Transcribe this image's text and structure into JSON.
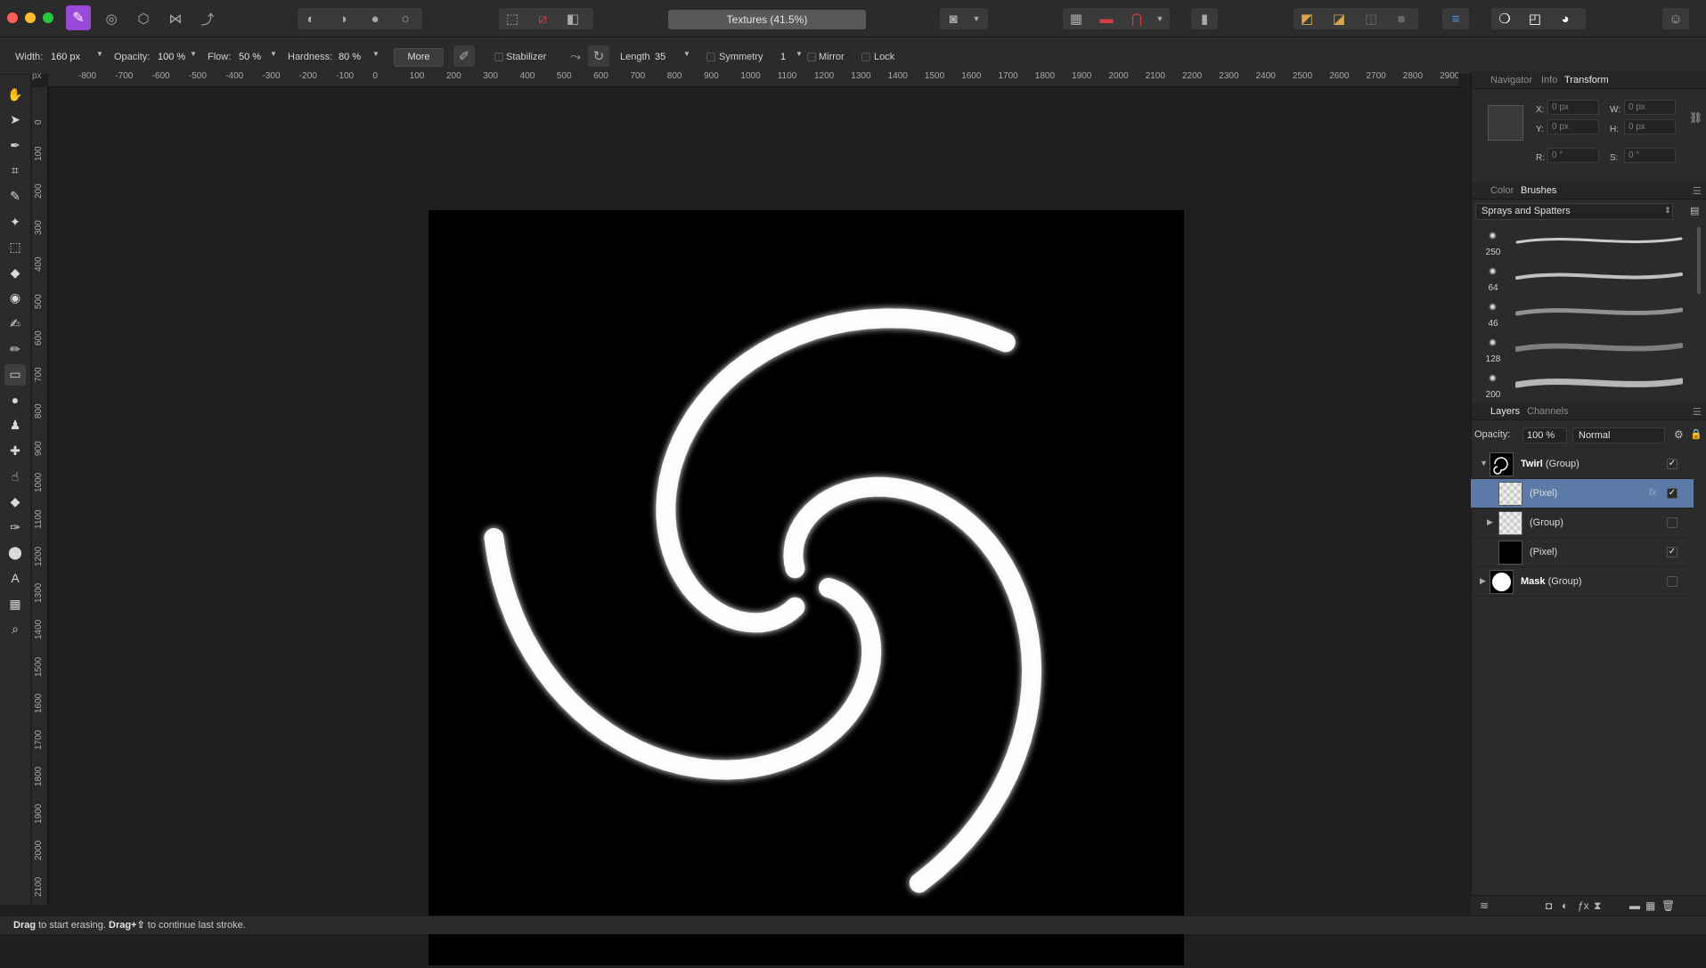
{
  "app": {
    "document_title": "Textures (41.5%)",
    "colors": {
      "accent_selected": "#5b7aa8",
      "app_icon": "#9a49d8",
      "toolbar_red": "#d44141"
    }
  },
  "context_toolbar": {
    "width_label": "Width:",
    "width_value": "160 px",
    "opacity_label": "Opacity:",
    "opacity_value": "100 %",
    "flow_label": "Flow:",
    "flow_value": "50 %",
    "hardness_label": "Hardness:",
    "hardness_value": "80 %",
    "more_label": "More",
    "stabilizer_label": "Stabilizer",
    "length_label": "Length",
    "length_value": "35",
    "symmetry_label": "Symmetry",
    "symmetry_value": "1",
    "mirror_label": "Mirror",
    "lock_label": "Lock"
  },
  "rulers": {
    "unit": "px",
    "horizontal": [
      "-800",
      "-700",
      "-600",
      "-500",
      "-400",
      "-300",
      "-200",
      "-100",
      "0",
      "100",
      "200",
      "300",
      "400",
      "500",
      "600",
      "700",
      "800",
      "900",
      "1000",
      "1100",
      "1200",
      "1300",
      "1400",
      "1500",
      "1600",
      "1700",
      "1800",
      "1900",
      "2000",
      "2100",
      "2200",
      "2300",
      "2400",
      "2500",
      "2600",
      "2700",
      "2800",
      "2900"
    ],
    "vertical": [
      "0",
      "100",
      "200",
      "300",
      "400",
      "500",
      "600",
      "700",
      "800",
      "900",
      "1000",
      "1100",
      "1200",
      "1300",
      "1400",
      "1500",
      "1600",
      "1700",
      "1800",
      "1900",
      "2000",
      "2100"
    ]
  },
  "left_tools": [
    "hand-icon",
    "move-icon",
    "color-picker-icon",
    "crop-icon",
    "selection-brush-icon",
    "magic-wand-icon",
    "rect-marquee-icon",
    "flood-fill-icon",
    "gradient-icon",
    "paint-brush-icon",
    "color-replace-icon",
    "erase-brush-icon",
    "dodge-icon",
    "clone-icon",
    "healing-icon",
    "smudge-icon",
    "rectangle-shape-icon",
    "pen-icon",
    "ellipse-shape-icon",
    "text-icon",
    "mesh-warp-icon",
    "zoom-icon"
  ],
  "transform_panel": {
    "tabs": [
      "Navigator",
      "Info",
      "Transform"
    ],
    "active_tab": "Transform",
    "x_label": "X:",
    "x_value": "0 px",
    "y_label": "Y:",
    "y_value": "0 px",
    "w_label": "W:",
    "w_value": "0 px",
    "h_label": "H:",
    "h_value": "0 px",
    "r_label": "R:",
    "r_value": "0 °",
    "s_label": "S:",
    "s_value": "0 °"
  },
  "brushes_panel": {
    "tabs": [
      "Color",
      "Brushes"
    ],
    "active_tab": "Brushes",
    "category": "Sprays and Spatters",
    "brushes": [
      {
        "size": "250"
      },
      {
        "size": "64"
      },
      {
        "size": "46"
      },
      {
        "size": "128"
      },
      {
        "size": "200"
      }
    ]
  },
  "layers_panel": {
    "tabs": [
      "Layers",
      "Channels"
    ],
    "active_tab": "Layers",
    "opacity_label": "Opacity:",
    "opacity_value": "100 %",
    "blend_mode": "Normal",
    "layers": [
      {
        "name": "Twirl",
        "type": "(Group)",
        "checked": "✓"
      },
      {
        "name": "",
        "type": "(Pixel)",
        "checked": "✓"
      },
      {
        "name": "",
        "type": "(Group)",
        "checked": ""
      },
      {
        "name": "",
        "type": "(Pixel)",
        "checked": "✓"
      },
      {
        "name": "Mask",
        "type": "(Group)",
        "checked": ""
      }
    ]
  },
  "status_bar": {
    "drag1": "Drag",
    "text1": " to start erasing. ",
    "drag2": "Drag+⇧",
    "text2": " to continue last stroke."
  }
}
